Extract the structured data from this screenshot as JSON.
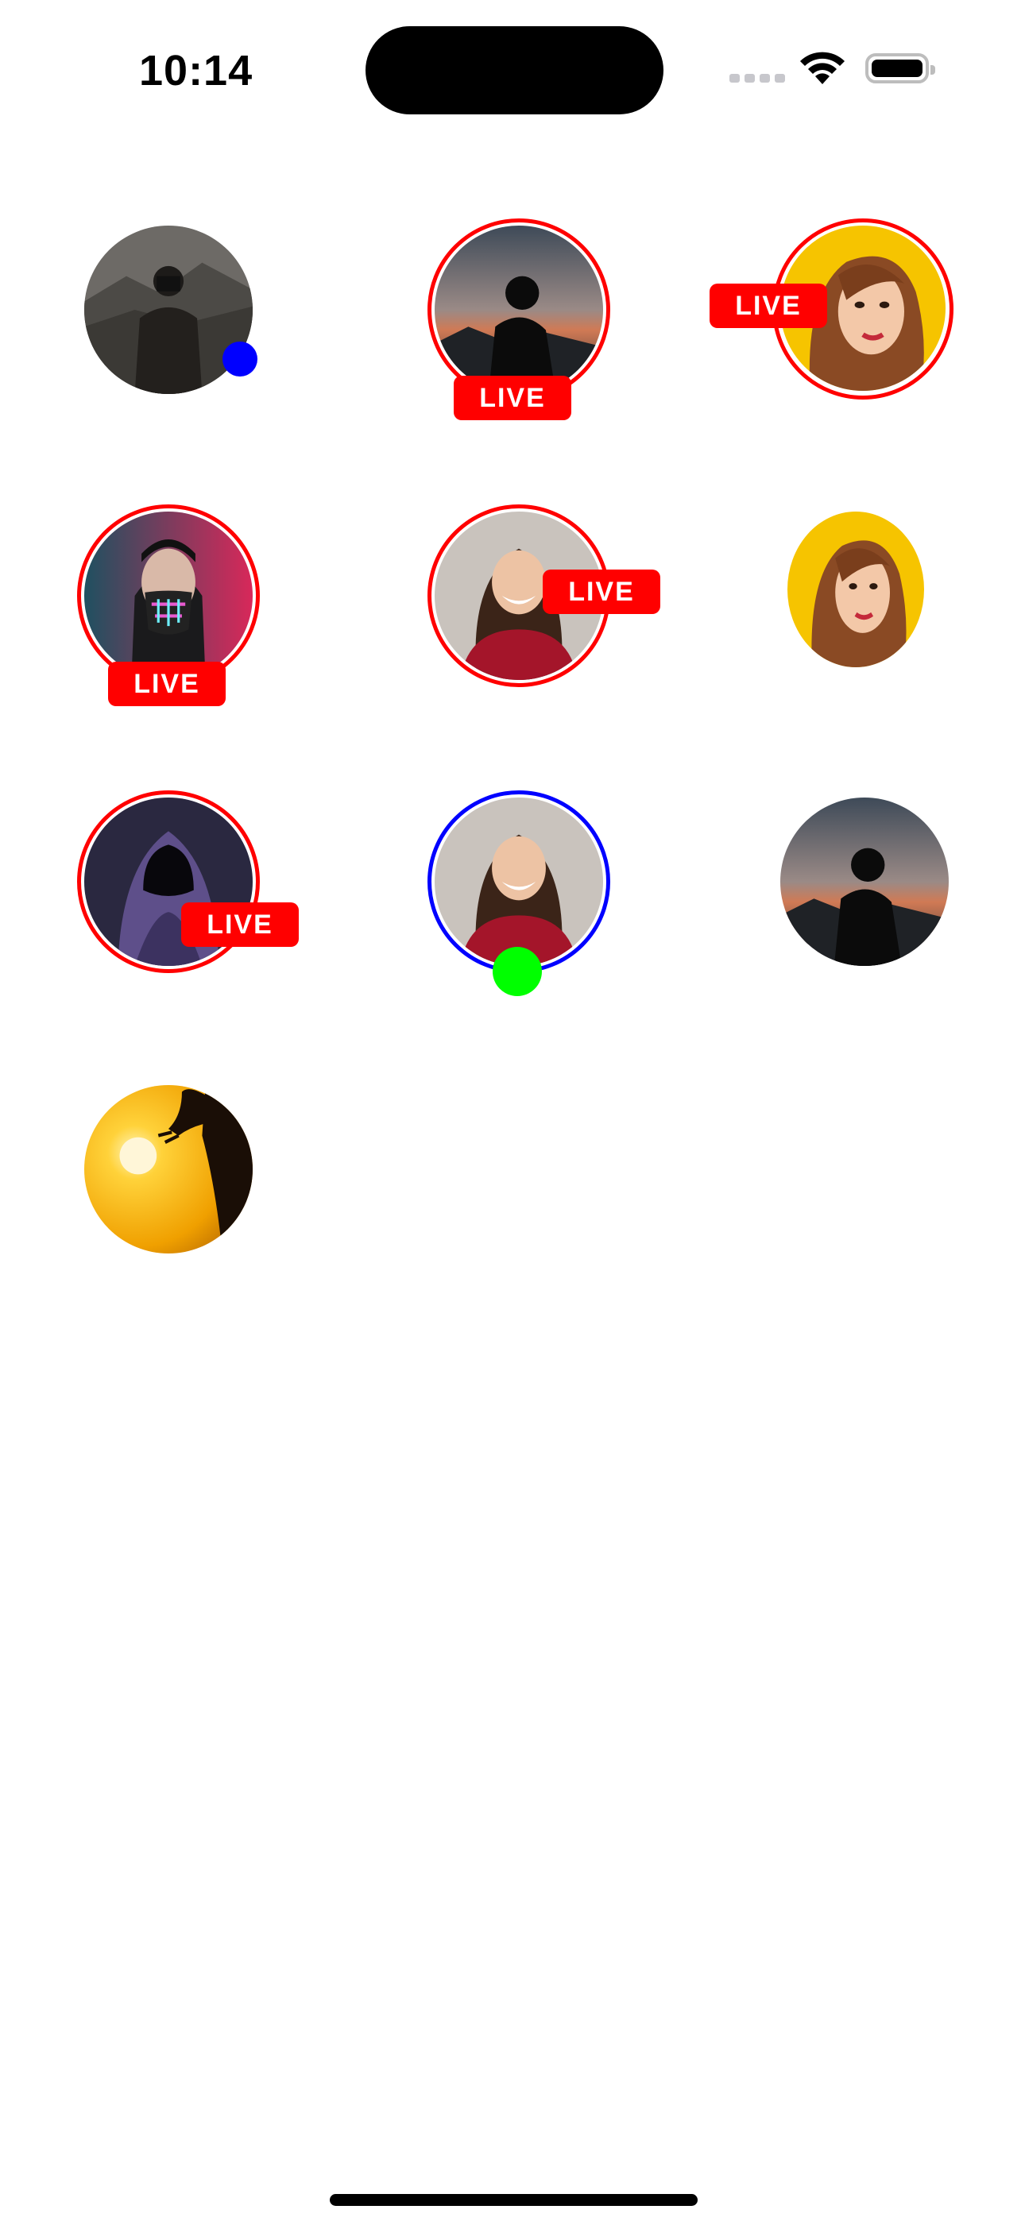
{
  "status_bar": {
    "time": "10:14",
    "icons": [
      "signal-icon",
      "wifi-icon",
      "battery-icon"
    ]
  },
  "avatars": [
    {
      "image": "photographer",
      "live": false,
      "indicator": "blue-dot"
    },
    {
      "image": "silhouette-sunset",
      "live": true,
      "live_label": "LIVE",
      "ring": "red"
    },
    {
      "image": "illustrated-woman",
      "live": true,
      "live_label": "LIVE",
      "ring": "red"
    },
    {
      "image": "masked-man",
      "live": true,
      "live_label": "LIVE",
      "ring": "red"
    },
    {
      "image": "smiling-woman",
      "live": true,
      "live_label": "LIVE",
      "ring": "red"
    },
    {
      "image": "illustrated-woman",
      "live": false
    },
    {
      "image": "hooded-figure",
      "live": true,
      "live_label": "LIVE",
      "ring": "red"
    },
    {
      "image": "smiling-woman",
      "live": false,
      "ring": "blue",
      "indicator": "green-dot"
    },
    {
      "image": "silhouette-sunset",
      "live": false
    },
    {
      "image": "sunset-bird",
      "live": false
    }
  ],
  "colors": {
    "live_red": "#ff0000",
    "ring_blue": "#0000ff",
    "online_green": "#00ff00",
    "dot_blue": "#0000ff"
  }
}
